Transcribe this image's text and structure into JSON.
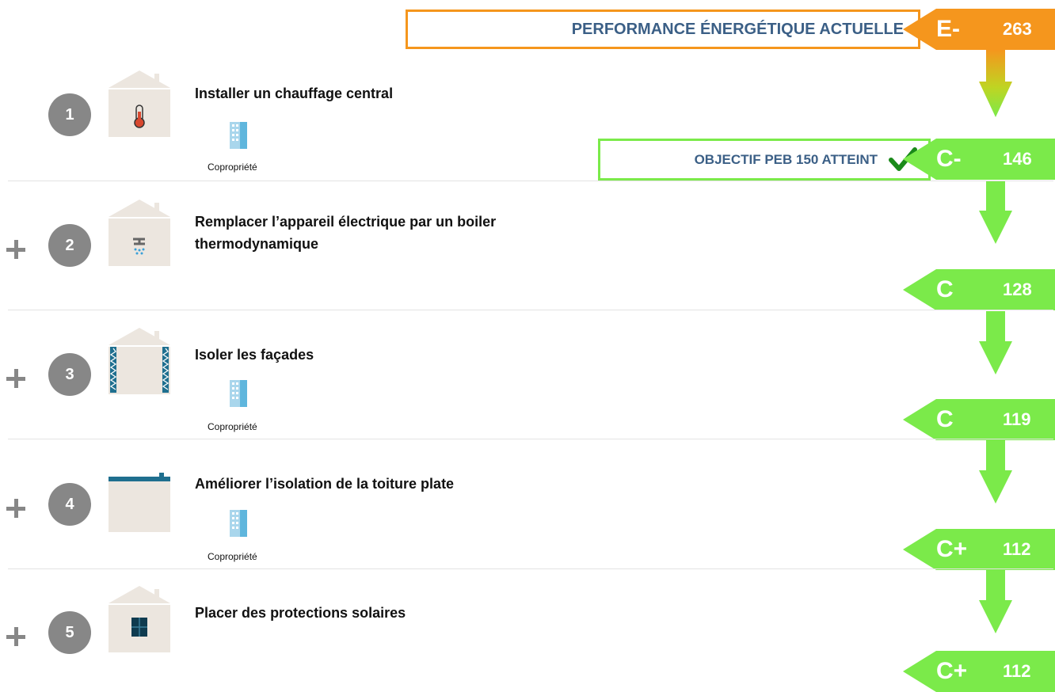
{
  "header": {
    "label": "PERFORMANCE ÉNERGÉTIQUE ACTUELLE",
    "class": "E-",
    "value": "263",
    "color": "#f5961d"
  },
  "target": {
    "label": "OBJECTIF PEB 150 ATTEINT",
    "class": "C-",
    "value": "146",
    "color": "#7bea4a",
    "check_icon": "check-icon"
  },
  "steps": [
    {
      "number": "1",
      "title": "Installer un chauffage central",
      "icon": "thermometer-icon",
      "copro": "Copropriété"
    },
    {
      "number": "2",
      "title": "Remplacer l’appareil électrique par un boiler thermodynamique",
      "icon": "shower-icon",
      "copro": ""
    },
    {
      "number": "3",
      "title": "Isoler les façades",
      "icon": "facade-insulation-icon",
      "copro": "Copropriété"
    },
    {
      "number": "4",
      "title": "Améliorer l’isolation de la toiture plate",
      "icon": "flat-roof-icon",
      "copro": "Copropriété"
    },
    {
      "number": "5",
      "title": "Placer des protections solaires",
      "icon": "window-shutter-icon",
      "copro": ""
    }
  ],
  "results": [
    {
      "class": "C",
      "value": "128"
    },
    {
      "class": "C",
      "value": "119"
    },
    {
      "class": "C+",
      "value": "112"
    },
    {
      "class": "C+",
      "value": "112"
    }
  ],
  "colors": {
    "green": "#7bea4a",
    "orange": "#f5961d",
    "label_blue": "#3b5f86",
    "grey": "#878787"
  }
}
